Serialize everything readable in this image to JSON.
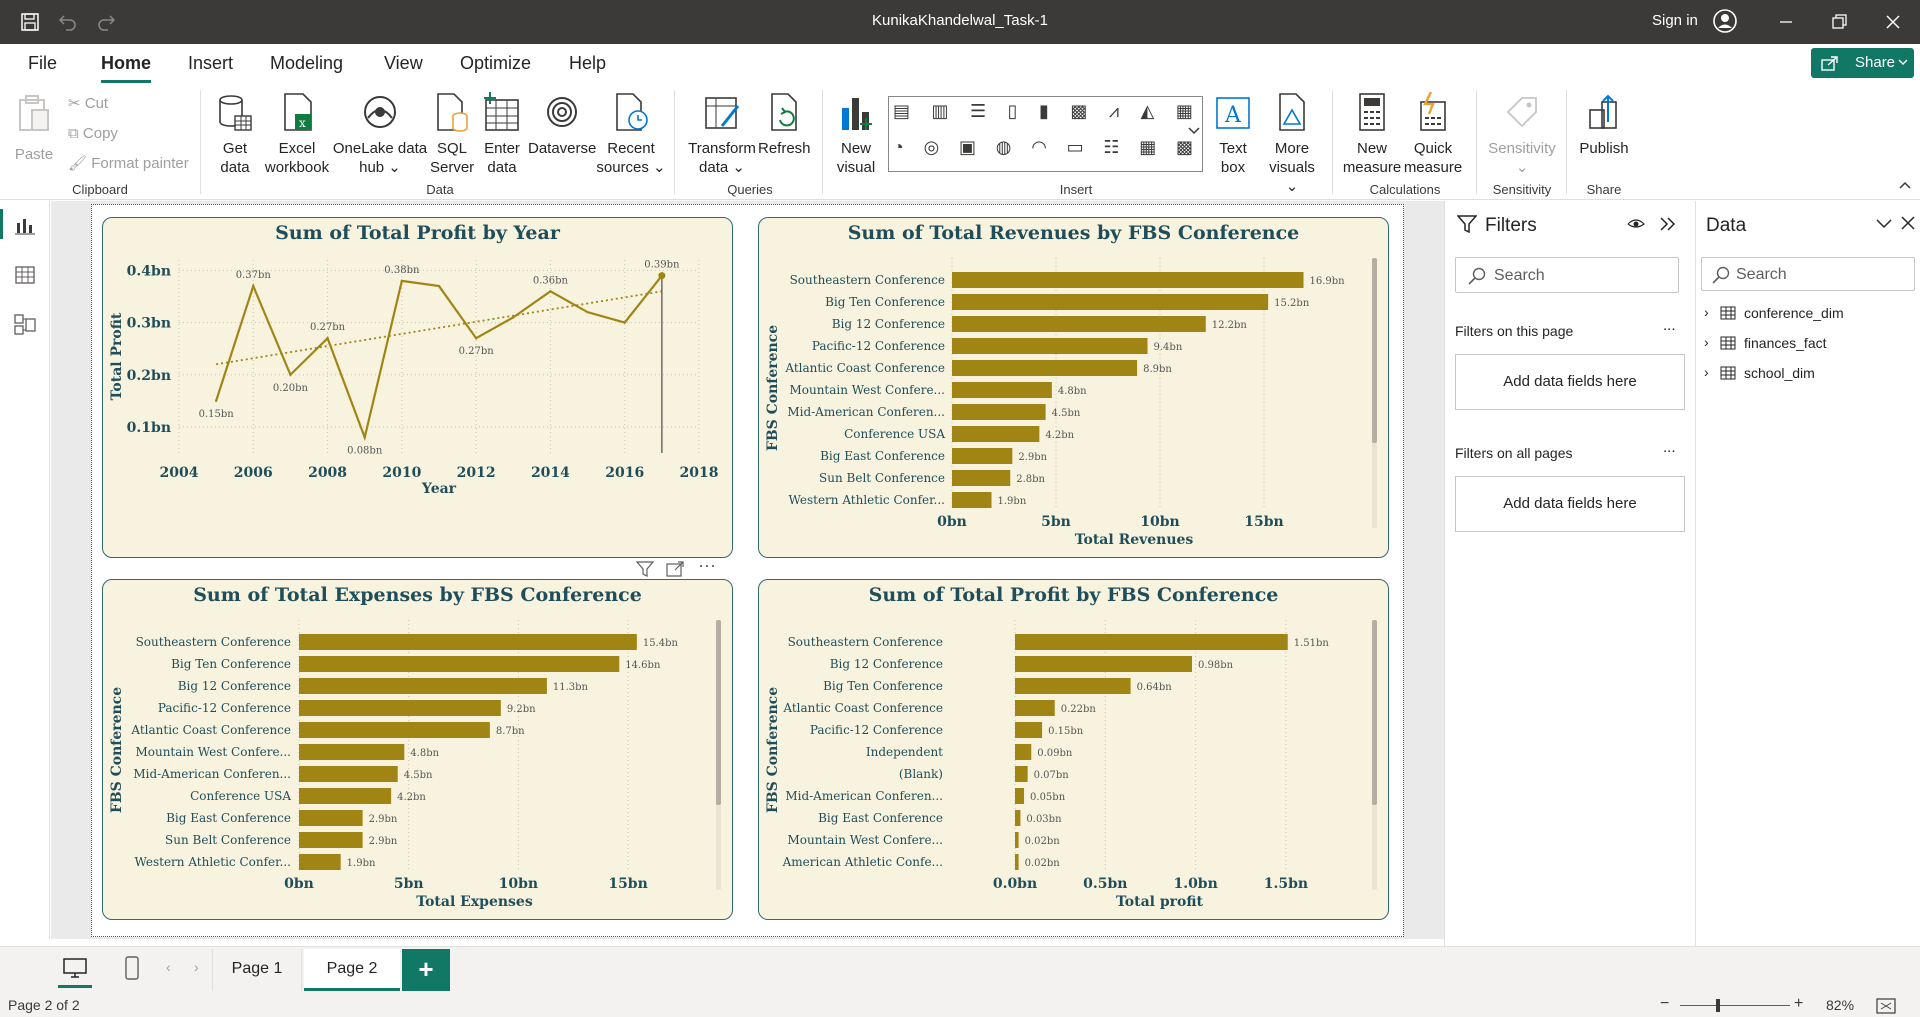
{
  "window": {
    "title": "KunikaKhandelwal_Task-1",
    "sign_in": "Sign in"
  },
  "menu": {
    "tabs": [
      "File",
      "Home",
      "Insert",
      "Modeling",
      "View",
      "Optimize",
      "Help"
    ],
    "active": "Home",
    "share": "Share"
  },
  "ribbon": {
    "clipboard": {
      "paste": "Paste",
      "cut": "Cut",
      "copy": "Copy",
      "format_painter": "Format painter",
      "group": "Clipboard"
    },
    "data": {
      "get_data": [
        "Get",
        "data"
      ],
      "excel": [
        "Excel",
        "workbook"
      ],
      "onelake": [
        "OneLake data",
        "hub"
      ],
      "sql": [
        "SQL",
        "Server"
      ],
      "enter": [
        "Enter",
        "data"
      ],
      "dataverse": "Dataverse",
      "recent": [
        "Recent",
        "sources"
      ],
      "group": "Data"
    },
    "queries": {
      "transform": [
        "Transform",
        "data"
      ],
      "refresh": "Refresh",
      "group": "Queries"
    },
    "insert": {
      "new_visual": [
        "New",
        "visual"
      ],
      "text_box": [
        "Text",
        "box"
      ],
      "more_visuals": [
        "More",
        "visuals"
      ],
      "group": "Insert"
    },
    "calculations": {
      "new_measure": [
        "New",
        "measure"
      ],
      "quick_measure": [
        "Quick",
        "measure"
      ],
      "group": "Calculations"
    },
    "sensitivity": {
      "label": "Sensitivity",
      "group": "Sensitivity"
    },
    "share": {
      "publish": "Publish",
      "group": "Share"
    }
  },
  "filters": {
    "title": "Filters",
    "search": "Search",
    "on_this_page": "Filters on this page",
    "on_all_pages": "Filters on all pages",
    "add_fields": "Add data fields here",
    "more": "..."
  },
  "data_pane": {
    "title": "Data",
    "search": "Search",
    "tables": [
      "conference_dim",
      "finances_fact",
      "school_dim"
    ]
  },
  "pages": {
    "tabs": [
      "Page 1",
      "Page 2"
    ],
    "active": "Page 2",
    "add": "+"
  },
  "status": {
    "page_info": "Page 2 of 2",
    "zoom": "82%"
  },
  "colors": {
    "bar": "#a08514",
    "visual_bg": "#f7f3df",
    "title": "#1f4e5a",
    "accent": "#117865"
  },
  "chart_data": [
    {
      "type": "line",
      "title": "Sum of Total Profit by Year",
      "xlabel": "Year",
      "ylabel": "Total Profit",
      "x": [
        2005,
        2006,
        2007,
        2008,
        2009,
        2010,
        2011,
        2012,
        2013,
        2014,
        2015,
        2016,
        2017
      ],
      "values": [
        0.15,
        0.37,
        0.2,
        0.27,
        0.08,
        0.38,
        0.37,
        0.27,
        0.31,
        0.36,
        0.32,
        0.3,
        0.39
      ],
      "data_labels": {
        "2005": "0.15bn",
        "2006": "0.37bn",
        "2007": "0.20bn",
        "2008": "0.27bn",
        "2009": "0.08bn",
        "2010": "0.38bn",
        "2012": "0.27bn",
        "2014": "0.36bn",
        "2017": "0.39bn"
      },
      "trendline": [
        0.22,
        0.36
      ],
      "xticks": [
        "2004",
        "2006",
        "2008",
        "2010",
        "2012",
        "2014",
        "2016",
        "2018"
      ],
      "yticks": [
        "0.1bn",
        "0.2bn",
        "0.3bn",
        "0.4bn"
      ],
      "xlim": [
        2004,
        2018
      ],
      "ylim": [
        0.05,
        0.42
      ]
    },
    {
      "type": "bar",
      "title": "Sum of Total Revenues by FBS Conference",
      "xlabel": "Total Revenues",
      "ylabel": "FBS Conference",
      "categories": [
        "Southeastern Conference",
        "Big Ten Conference",
        "Big 12 Conference",
        "Pacific-12 Conference",
        "Atlantic Coast Conference",
        "Mountain West Confere...",
        "Mid-American Conferen...",
        "Conference USA",
        "Big East Conference",
        "Sun Belt Conference",
        "Western Athletic Confer..."
      ],
      "values": [
        16.9,
        15.2,
        12.2,
        9.4,
        8.9,
        4.8,
        4.5,
        4.2,
        2.9,
        2.8,
        1.9
      ],
      "labels": [
        "16.9bn",
        "15.2bn",
        "12.2bn",
        "9.4bn",
        "8.9bn",
        "4.8bn",
        "4.5bn",
        "4.2bn",
        "2.9bn",
        "2.8bn",
        "1.9bn"
      ],
      "xticks": [
        "0bn",
        "5bn",
        "10bn",
        "15bn"
      ],
      "xtick_values": [
        0,
        5,
        10,
        15
      ],
      "xlim": [
        0,
        17.5
      ]
    },
    {
      "type": "bar",
      "title": "Sum of Total Expenses by FBS Conference",
      "xlabel": "Total Expenses",
      "ylabel": "FBS Conference",
      "categories": [
        "Southeastern Conference",
        "Big Ten Conference",
        "Big 12 Conference",
        "Pacific-12 Conference",
        "Atlantic Coast Conference",
        "Mountain West Confere...",
        "Mid-American Conferen...",
        "Conference USA",
        "Big East Conference",
        "Sun Belt Conference",
        "Western Athletic Confer..."
      ],
      "values": [
        15.4,
        14.6,
        11.3,
        9.2,
        8.7,
        4.8,
        4.5,
        4.2,
        2.9,
        2.9,
        1.9
      ],
      "labels": [
        "15.4bn",
        "14.6bn",
        "11.3bn",
        "9.2bn",
        "8.7bn",
        "4.8bn",
        "4.5bn",
        "4.2bn",
        "2.9bn",
        "2.9bn",
        "1.9bn"
      ],
      "xticks": [
        "0bn",
        "5bn",
        "10bn",
        "15bn"
      ],
      "xtick_values": [
        0,
        5,
        10,
        15
      ],
      "xlim": [
        0,
        16
      ]
    },
    {
      "type": "bar",
      "title": "Sum of Total Profit by FBS Conference",
      "xlabel": "Total profit",
      "ylabel": "FBS Conference",
      "categories": [
        "Southeastern Conference",
        "Big 12 Conference",
        "Big Ten Conference",
        "Atlantic Coast Conference",
        "Pacific-12 Conference",
        "Independent",
        "(Blank)",
        "Mid-American Conferen...",
        "Big East Conference",
        "Mountain West Confere...",
        "American Athletic Confe..."
      ],
      "values": [
        1.51,
        0.98,
        0.64,
        0.22,
        0.15,
        0.09,
        0.07,
        0.05,
        0.03,
        0.02,
        0.02
      ],
      "labels": [
        "1.51bn",
        "0.98bn",
        "0.64bn",
        "0.22bn",
        "0.15bn",
        "0.09bn",
        "0.07bn",
        "0.05bn",
        "0.03bn",
        "0.02bn",
        "0.02bn"
      ],
      "xticks": [
        "0.0bn",
        "0.5bn",
        "1.0bn",
        "1.5bn"
      ],
      "xtick_values": [
        0,
        0.5,
        1.0,
        1.5
      ],
      "xlim": [
        0,
        1.6
      ]
    }
  ]
}
